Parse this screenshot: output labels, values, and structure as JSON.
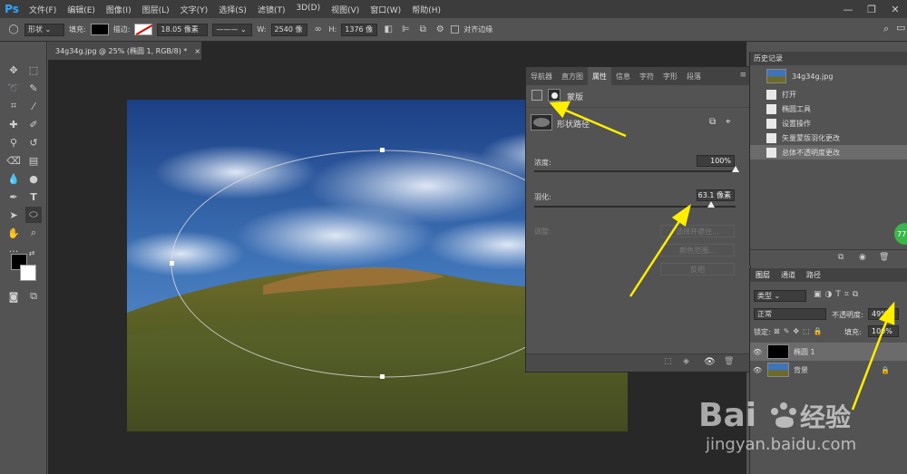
{
  "app": {
    "logo": "Ps"
  },
  "menu": [
    "文件(F)",
    "编辑(E)",
    "图像(I)",
    "图层(L)",
    "文字(Y)",
    "选择(S)",
    "滤镜(T)",
    "3D(D)",
    "视图(V)",
    "窗口(W)",
    "帮助(H)"
  ],
  "window_controls": {
    "minimize": "—",
    "restore": "❐",
    "close": "✕"
  },
  "options": {
    "mode": "形状",
    "fill_label": "填充:",
    "stroke_label": "描边:",
    "stroke_width": "18.05 像素",
    "w_label": "W:",
    "w_value": "2540 像",
    "h_label": "H:",
    "h_value": "1376 像",
    "align_edges": "对齐边缘"
  },
  "document": {
    "tab_title": "34g34g.jpg @ 25% (椭圆 1, RGB/8) *",
    "tab_close": "×"
  },
  "properties": {
    "tabs": [
      "导航器",
      "直方图",
      "属性",
      "信息",
      "字符",
      "字形",
      "段落"
    ],
    "active_tab": 2,
    "section_label": "蒙版",
    "shape_path_label": "形状路径",
    "density_label": "浓度:",
    "density_value": "100%",
    "density": 1.0,
    "feather_label": "羽化:",
    "feather_value": "63.1 像素",
    "feather": 0.88,
    "adjust_label": "调整:",
    "select_and_mask": "选择并遮住...",
    "color_range": "颜色范围...",
    "invert": "反相"
  },
  "history": {
    "title": "历史记录",
    "snapshot": "34g34g.jpg",
    "items": [
      "打开",
      "椭圆工具",
      "设置操作",
      "矢量蒙版羽化更改",
      "总体不透明度更改"
    ],
    "active_index": 4
  },
  "layers": {
    "tabs": [
      "图层",
      "通道",
      "路径"
    ],
    "filter_kind": "类型",
    "blend_mode": "正常",
    "opacity_label": "不透明度:",
    "opacity_value": "49%",
    "lock_label": "锁定:",
    "fill_label": "填充:",
    "fill_value": "100%",
    "items": [
      "椭圆 1",
      "背景"
    ]
  },
  "colors": {
    "accent": "#31a8ff",
    "arrow": "#ffee00",
    "history_active": "#6b6b6b"
  }
}
